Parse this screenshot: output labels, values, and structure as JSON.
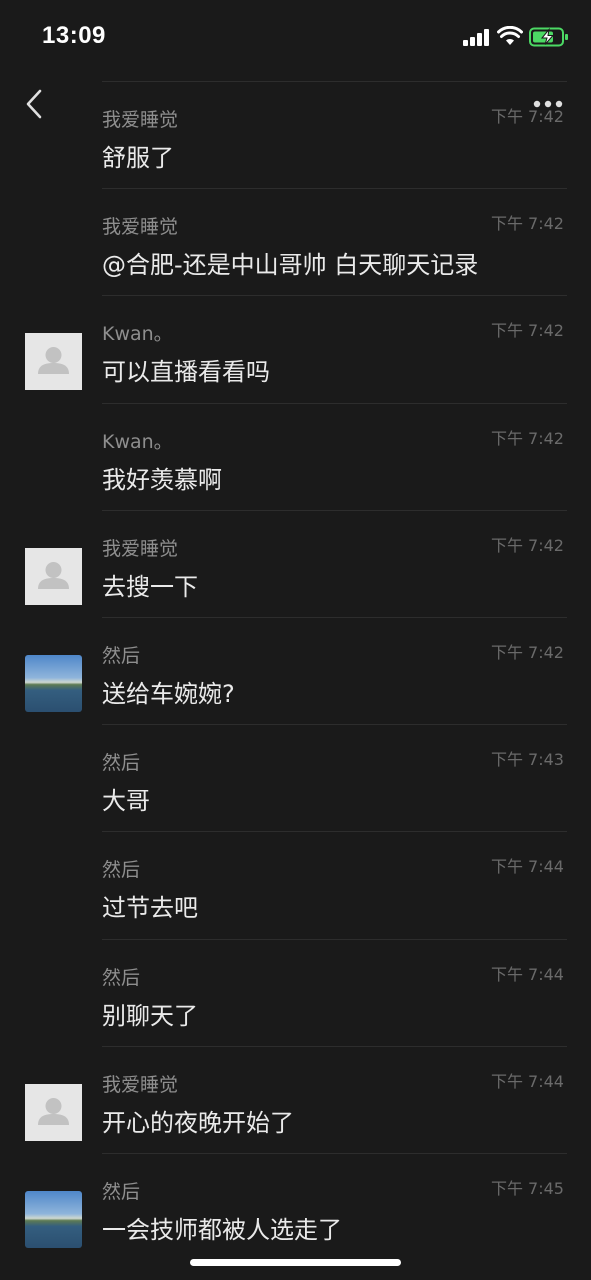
{
  "status_bar": {
    "time": "13:09"
  },
  "icons": {
    "back": "chevron-left-icon",
    "more": "more-dots-icon",
    "signal": "signal-icon",
    "wifi": "wifi-icon",
    "battery": "battery-charging-icon"
  },
  "colors": {
    "background": "#1a1a1a",
    "battery_fill": "#4cd964",
    "time_text": "#6a6a6a"
  },
  "messages": [
    {
      "sender": "我爱睡觉",
      "time": "下午 7:42",
      "text": "舒服了",
      "avatar": "none"
    },
    {
      "sender": "我爱睡觉",
      "time": "下午 7:42",
      "text": "@合肥-还是中山哥帅 白天聊天记录",
      "avatar": "none"
    },
    {
      "sender": "Kwan。",
      "time": "下午 7:42",
      "text": "可以直播看看吗",
      "avatar": "default"
    },
    {
      "sender": "Kwan。",
      "time": "下午 7:42",
      "text": "我好羡慕啊",
      "avatar": "none"
    },
    {
      "sender": "我爱睡觉",
      "time": "下午 7:42",
      "text": "去搜一下",
      "avatar": "default"
    },
    {
      "sender": "然后",
      "time": "下午 7:42",
      "text": "送给车婉婉?",
      "avatar": "landscape"
    },
    {
      "sender": "然后",
      "time": "下午 7:43",
      "text": "大哥",
      "avatar": "none"
    },
    {
      "sender": "然后",
      "time": "下午 7:44",
      "text": "过节去吧",
      "avatar": "none"
    },
    {
      "sender": "然后",
      "time": "下午 7:44",
      "text": "别聊天了",
      "avatar": "none"
    },
    {
      "sender": "我爱睡觉",
      "time": "下午 7:44",
      "text": "开心的夜晚开始了",
      "avatar": "default"
    },
    {
      "sender": "然后",
      "time": "下午 7:45",
      "text": "一会技师都被人选走了",
      "avatar": "landscape"
    }
  ]
}
